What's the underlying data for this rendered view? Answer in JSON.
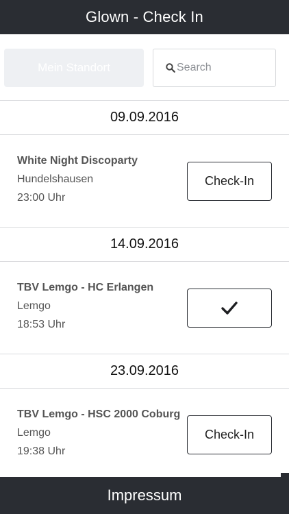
{
  "header": {
    "title": "Glown - Check In"
  },
  "controls": {
    "location_label": "Mein Standort",
    "search_placeholder": "Search"
  },
  "sections": [
    {
      "date": "09.09.2016",
      "event": {
        "title": "White Night Discoparty",
        "place": "Hundelshausen",
        "time": "23:00 Uhr",
        "button_label": "Check-In",
        "checked_in": false
      }
    },
    {
      "date": "14.09.2016",
      "event": {
        "title": "TBV Lemgo - HC Erlangen",
        "place": "Lemgo",
        "time": "18:53 Uhr",
        "button_label": "",
        "checked_in": true
      }
    },
    {
      "date": "23.09.2016",
      "event": {
        "title": "TBV Lemgo - HSC 2000 Coburg",
        "place": "Lemgo",
        "time": "19:38 Uhr",
        "button_label": "Check-In",
        "checked_in": false
      }
    }
  ],
  "footer": {
    "label": "Impressum"
  },
  "colors": {
    "bar": "#2a2d33",
    "divider": "#d9dadd"
  }
}
